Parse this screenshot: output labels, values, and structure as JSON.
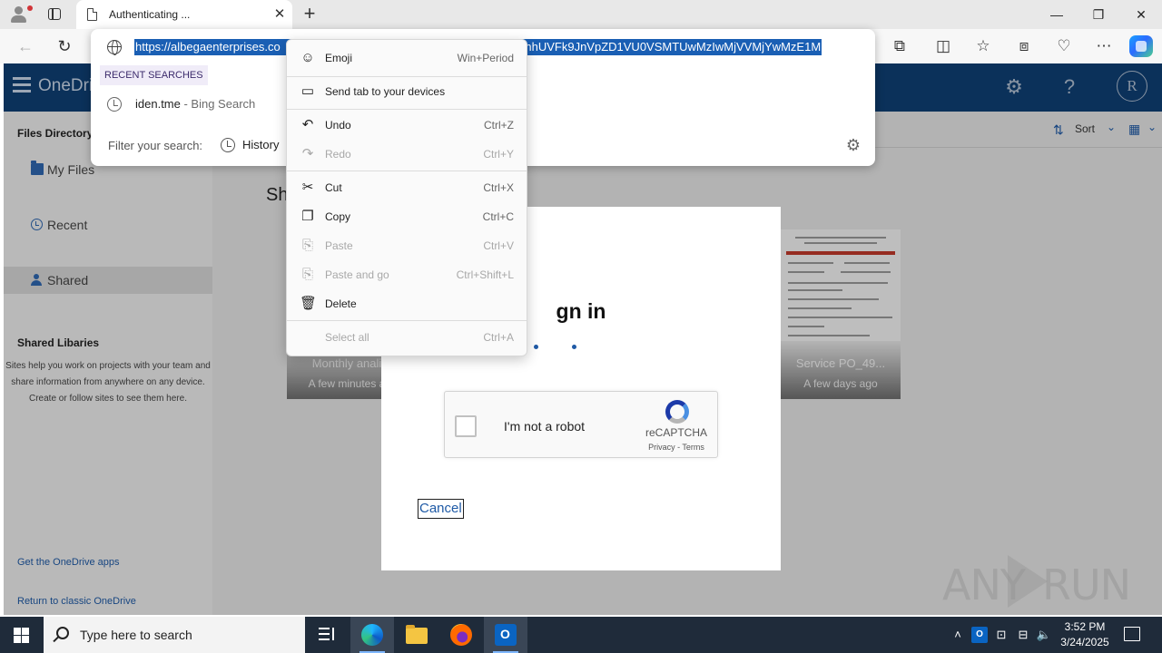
{
  "browser": {
    "tab_title": "Authenticating ...",
    "address_url": "https://albegaenterprises.com/wVmhUVFk9JnVpZD1VU0VSMTUwMzIwMjVVMjYwMzE1M",
    "url_visible_left": "https://albegaenterprises.co",
    "url_visible_right": "wVmhUVFk9JnVpZD1VU0VSMTUwMzIwMjVVMjYwMzE1M"
  },
  "omnibox": {
    "recent_header": "RECENT SEARCHES",
    "recent_items": [
      {
        "query": "iden.tme",
        "source": " - Bing Search"
      }
    ],
    "filter_label": "Filter your search:",
    "history_label": "History"
  },
  "context_menu": {
    "items": [
      {
        "label": "Emoji",
        "shortcut": "Win+Period",
        "enabled": true
      },
      {
        "label": "Send tab to your devices",
        "shortcut": "",
        "enabled": true
      },
      {
        "label": "Undo",
        "shortcut": "Ctrl+Z",
        "enabled": true
      },
      {
        "label": "Redo",
        "shortcut": "Ctrl+Y",
        "enabled": false
      },
      {
        "label": "Cut",
        "shortcut": "Ctrl+X",
        "enabled": true
      },
      {
        "label": "Copy",
        "shortcut": "Ctrl+C",
        "enabled": true
      },
      {
        "label": "Paste",
        "shortcut": "Ctrl+V",
        "enabled": false
      },
      {
        "label": "Paste and go",
        "shortcut": "Ctrl+Shift+L",
        "enabled": false
      },
      {
        "label": "Delete",
        "shortcut": "",
        "enabled": true
      },
      {
        "label": "Select all",
        "shortcut": "Ctrl+A",
        "enabled": false
      }
    ]
  },
  "onedrive": {
    "brand": "OneDrive",
    "avatar_initial": "R",
    "sidebar": {
      "directory_heading": "Files Directory",
      "items": [
        {
          "label": "My Files"
        },
        {
          "label": "Recent"
        },
        {
          "label": "Shared"
        }
      ],
      "libraries_heading": "Shared Libaries",
      "libraries_desc": "Sites help you work on projects with your team and share information from    anywhere on any device. Create or follow    sites to see them here.",
      "get_apps_link": "Get the OneDrive apps",
      "classic_link": "Return to classic OneDrive"
    },
    "cmdbar": {
      "sort_label": "Sort"
    },
    "section_title": "Sh",
    "cards": [
      {
        "name": "Monthly anali",
        "when": "A few minutes a"
      },
      {
        "name": "Service PO_49...",
        "when": "A few days ago"
      }
    ]
  },
  "signin_modal": {
    "title": "gn in",
    "captcha_label": "I'm not a robot",
    "captcha_brand": "reCAPTCHA",
    "captcha_links": "Privacy - Terms",
    "cancel_label": "Cancel"
  },
  "watermark": {
    "left": "ANY",
    "right": "RUN"
  },
  "taskbar": {
    "search_placeholder": "Type here to search",
    "time": "3:52 PM",
    "date": "3/24/2025"
  },
  "colors": {
    "onedrive_header": "#0f3f74",
    "selection": "#1a5fb4",
    "link": "#1f5aa6",
    "taskbar": "#1f2b3a"
  }
}
